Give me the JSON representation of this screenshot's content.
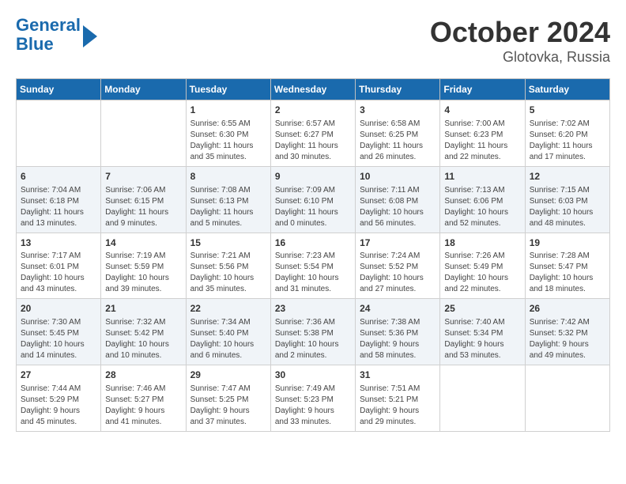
{
  "logo": {
    "line1": "General",
    "line2": "Blue"
  },
  "title": "October 2024",
  "location": "Glotovka, Russia",
  "weekdays": [
    "Sunday",
    "Monday",
    "Tuesday",
    "Wednesday",
    "Thursday",
    "Friday",
    "Saturday"
  ],
  "weeks": [
    [
      {
        "day": "",
        "info": ""
      },
      {
        "day": "",
        "info": ""
      },
      {
        "day": "1",
        "info": "Sunrise: 6:55 AM\nSunset: 6:30 PM\nDaylight: 11 hours\nand 35 minutes."
      },
      {
        "day": "2",
        "info": "Sunrise: 6:57 AM\nSunset: 6:27 PM\nDaylight: 11 hours\nand 30 minutes."
      },
      {
        "day": "3",
        "info": "Sunrise: 6:58 AM\nSunset: 6:25 PM\nDaylight: 11 hours\nand 26 minutes."
      },
      {
        "day": "4",
        "info": "Sunrise: 7:00 AM\nSunset: 6:23 PM\nDaylight: 11 hours\nand 22 minutes."
      },
      {
        "day": "5",
        "info": "Sunrise: 7:02 AM\nSunset: 6:20 PM\nDaylight: 11 hours\nand 17 minutes."
      }
    ],
    [
      {
        "day": "6",
        "info": "Sunrise: 7:04 AM\nSunset: 6:18 PM\nDaylight: 11 hours\nand 13 minutes."
      },
      {
        "day": "7",
        "info": "Sunrise: 7:06 AM\nSunset: 6:15 PM\nDaylight: 11 hours\nand 9 minutes."
      },
      {
        "day": "8",
        "info": "Sunrise: 7:08 AM\nSunset: 6:13 PM\nDaylight: 11 hours\nand 5 minutes."
      },
      {
        "day": "9",
        "info": "Sunrise: 7:09 AM\nSunset: 6:10 PM\nDaylight: 11 hours\nand 0 minutes."
      },
      {
        "day": "10",
        "info": "Sunrise: 7:11 AM\nSunset: 6:08 PM\nDaylight: 10 hours\nand 56 minutes."
      },
      {
        "day": "11",
        "info": "Sunrise: 7:13 AM\nSunset: 6:06 PM\nDaylight: 10 hours\nand 52 minutes."
      },
      {
        "day": "12",
        "info": "Sunrise: 7:15 AM\nSunset: 6:03 PM\nDaylight: 10 hours\nand 48 minutes."
      }
    ],
    [
      {
        "day": "13",
        "info": "Sunrise: 7:17 AM\nSunset: 6:01 PM\nDaylight: 10 hours\nand 43 minutes."
      },
      {
        "day": "14",
        "info": "Sunrise: 7:19 AM\nSunset: 5:59 PM\nDaylight: 10 hours\nand 39 minutes."
      },
      {
        "day": "15",
        "info": "Sunrise: 7:21 AM\nSunset: 5:56 PM\nDaylight: 10 hours\nand 35 minutes."
      },
      {
        "day": "16",
        "info": "Sunrise: 7:23 AM\nSunset: 5:54 PM\nDaylight: 10 hours\nand 31 minutes."
      },
      {
        "day": "17",
        "info": "Sunrise: 7:24 AM\nSunset: 5:52 PM\nDaylight: 10 hours\nand 27 minutes."
      },
      {
        "day": "18",
        "info": "Sunrise: 7:26 AM\nSunset: 5:49 PM\nDaylight: 10 hours\nand 22 minutes."
      },
      {
        "day": "19",
        "info": "Sunrise: 7:28 AM\nSunset: 5:47 PM\nDaylight: 10 hours\nand 18 minutes."
      }
    ],
    [
      {
        "day": "20",
        "info": "Sunrise: 7:30 AM\nSunset: 5:45 PM\nDaylight: 10 hours\nand 14 minutes."
      },
      {
        "day": "21",
        "info": "Sunrise: 7:32 AM\nSunset: 5:42 PM\nDaylight: 10 hours\nand 10 minutes."
      },
      {
        "day": "22",
        "info": "Sunrise: 7:34 AM\nSunset: 5:40 PM\nDaylight: 10 hours\nand 6 minutes."
      },
      {
        "day": "23",
        "info": "Sunrise: 7:36 AM\nSunset: 5:38 PM\nDaylight: 10 hours\nand 2 minutes."
      },
      {
        "day": "24",
        "info": "Sunrise: 7:38 AM\nSunset: 5:36 PM\nDaylight: 9 hours\nand 58 minutes."
      },
      {
        "day": "25",
        "info": "Sunrise: 7:40 AM\nSunset: 5:34 PM\nDaylight: 9 hours\nand 53 minutes."
      },
      {
        "day": "26",
        "info": "Sunrise: 7:42 AM\nSunset: 5:32 PM\nDaylight: 9 hours\nand 49 minutes."
      }
    ],
    [
      {
        "day": "27",
        "info": "Sunrise: 7:44 AM\nSunset: 5:29 PM\nDaylight: 9 hours\nand 45 minutes."
      },
      {
        "day": "28",
        "info": "Sunrise: 7:46 AM\nSunset: 5:27 PM\nDaylight: 9 hours\nand 41 minutes."
      },
      {
        "day": "29",
        "info": "Sunrise: 7:47 AM\nSunset: 5:25 PM\nDaylight: 9 hours\nand 37 minutes."
      },
      {
        "day": "30",
        "info": "Sunrise: 7:49 AM\nSunset: 5:23 PM\nDaylight: 9 hours\nand 33 minutes."
      },
      {
        "day": "31",
        "info": "Sunrise: 7:51 AM\nSunset: 5:21 PM\nDaylight: 9 hours\nand 29 minutes."
      },
      {
        "day": "",
        "info": ""
      },
      {
        "day": "",
        "info": ""
      }
    ]
  ]
}
